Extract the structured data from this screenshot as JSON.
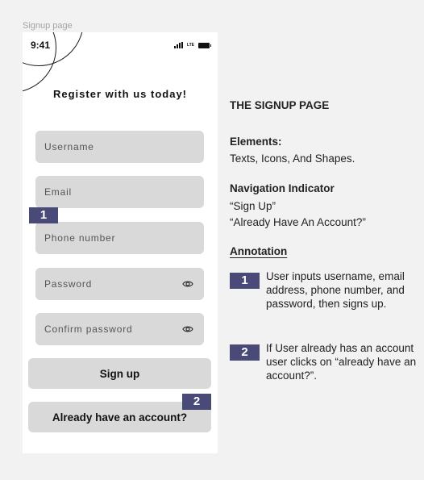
{
  "frame_label": "Signup page",
  "status_bar": {
    "time": "9:41",
    "network": "LTE"
  },
  "form": {
    "heading": "Register with us today!",
    "fields": [
      {
        "placeholder": "Username"
      },
      {
        "placeholder": "Email"
      },
      {
        "placeholder": "Phone number"
      },
      {
        "placeholder": "Password"
      },
      {
        "placeholder": "Confirm password"
      }
    ],
    "signup_label": "Sign up",
    "account_label": "Already have an account?"
  },
  "badges": {
    "one": "1",
    "two": "2"
  },
  "notes": {
    "title": "THE SIGNUP PAGE",
    "elements_title": "Elements:",
    "elements_text": "Texts, Icons, And Shapes.",
    "nav_title": "Navigation Indicator",
    "nav_items": [
      "“Sign Up”",
      "“Already Have An Account?”"
    ],
    "annotation_title": "Annotation",
    "annotations": [
      {
        "number": "1",
        "text": "User inputs username, email address, phone number, and password, then signs up."
      },
      {
        "number": "2",
        "text": "If User already has an account user clicks on “already have an account?”."
      }
    ]
  },
  "colors": {
    "badge": "#4a4a78",
    "field_bg": "#d9d9d9",
    "canvas_bg": "#f2f2f2"
  },
  "icons": {
    "password_toggle": "eye-icon",
    "signal": "signal-bars-icon",
    "battery": "battery-icon"
  }
}
